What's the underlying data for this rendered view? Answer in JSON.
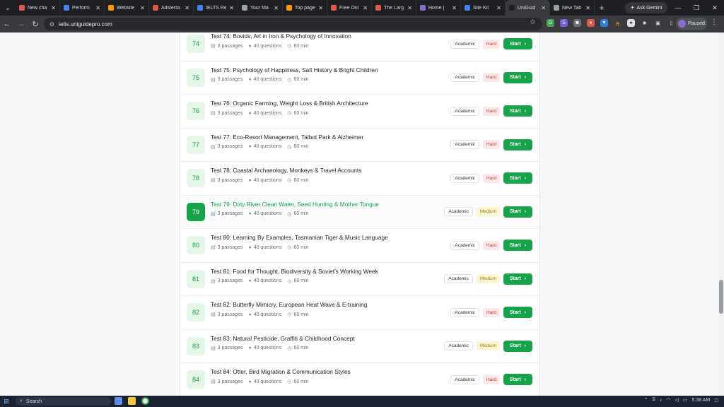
{
  "browser": {
    "tabs": [
      {
        "title": "New cha",
        "color": "#e2574c"
      },
      {
        "title": "Perform",
        "color": "#4285f4"
      },
      {
        "title": "Website",
        "color": "#ff9900"
      },
      {
        "title": "Adsterra",
        "color": "#e2574c"
      },
      {
        "title": "IELTS Re",
        "color": "#4285f4"
      },
      {
        "title": "Your Ma",
        "color": "#9aa0a6"
      },
      {
        "title": "Top page",
        "color": "#ff9900"
      },
      {
        "title": "Free Onl",
        "color": "#e2574c"
      },
      {
        "title": "The Larg",
        "color": "#e2574c"
      },
      {
        "title": "Home |",
        "color": "#8b6cd6"
      },
      {
        "title": "Site Kit",
        "color": "#4285f4"
      },
      {
        "title": "UniGuid",
        "color": "#202124",
        "active": true
      },
      {
        "title": "New Tab",
        "color": "#9aa0a6"
      }
    ],
    "ask_gemini": "Ask Gemini",
    "url": "ielts.uniguidepro.com",
    "profile_status": "Paused"
  },
  "tests": [
    {
      "num": "74",
      "title": "Test 74: Bovids, Art in Iron & Psychology of Innovation",
      "difficulty": "Hard"
    },
    {
      "num": "75",
      "title": "Test 75: Psychology of Happiness, Salt History & Bright Children",
      "difficulty": "Hard"
    },
    {
      "num": "76",
      "title": "Test 76: Organic Farming, Weight Loss & British Architecture",
      "difficulty": "Hard"
    },
    {
      "num": "77",
      "title": "Test 77: Eco-Resort Management, Talbot Park & Alzheimer",
      "difficulty": "Hard"
    },
    {
      "num": "78",
      "title": "Test 78: Coastal Archaeology, Monkeys & Travel Accounts",
      "difficulty": "Hard"
    },
    {
      "num": "79",
      "title": "Test 79: Dirty River Clean Water, Seed Hunting & Mother Tongue",
      "difficulty": "Medium",
      "current": true
    },
    {
      "num": "80",
      "title": "Test 80: Learning By Examples, Tasmanian Tiger & Music Language",
      "difficulty": "Hard"
    },
    {
      "num": "81",
      "title": "Test 81: Food for Thought, Biodiversity & Soviet's Working Week",
      "difficulty": "Medium"
    },
    {
      "num": "82",
      "title": "Test 82: Butterfly Mimicry, European Heat Wave & E-training",
      "difficulty": "Hard"
    },
    {
      "num": "83",
      "title": "Test 83: Natural Pesticide, Graffiti & Childhood Concept",
      "difficulty": "Medium"
    },
    {
      "num": "84",
      "title": "Test 84: Otter, Bird Migration & Communication Styles",
      "difficulty": "Hard"
    }
  ],
  "common": {
    "passages": "3 passages",
    "questions": "40 questions",
    "duration": "60 min",
    "category": "Academic",
    "start_label": "Start"
  },
  "taskbar": {
    "search_label": "Search",
    "time": "5:38 AM"
  }
}
